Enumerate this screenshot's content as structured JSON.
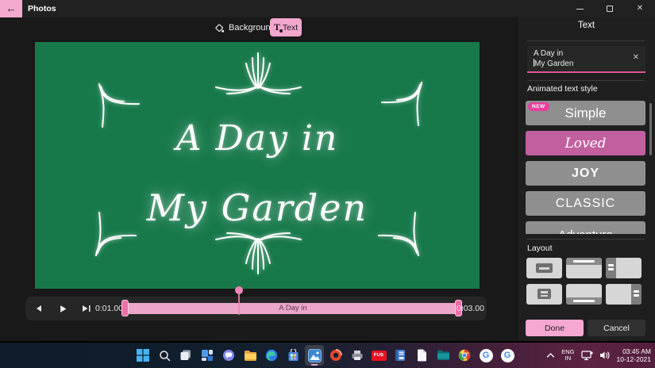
{
  "titlebar": {
    "app_title": "Photos",
    "back_glyph": "←",
    "close_glyph": "✕"
  },
  "toolbar": {
    "background_label": "Background",
    "text_icon_letter": "T",
    "text_label": "Text"
  },
  "canvas": {
    "line1": "A Day in",
    "line2": "My Garden",
    "background_color": "#17794a"
  },
  "playback": {
    "current_time": "0:01.00",
    "end_time": "0:03.00",
    "clip_label": "A Day in"
  },
  "panel": {
    "title": "Text",
    "input": {
      "line1": "A Day in",
      "line2": "My Garden",
      "clear_glyph": "✕"
    },
    "styles_heading": "Animated text style",
    "styles": [
      {
        "label": "Simple",
        "badge": "NEW",
        "selected": false
      },
      {
        "label": "Loved",
        "selected": true
      },
      {
        "label": "JOY",
        "selected": false
      },
      {
        "label": "CLASSIC",
        "selected": false
      },
      {
        "label": "Adventure",
        "selected": false,
        "partially_visible": true
      }
    ],
    "layout_heading": "Layout",
    "layout_options": [
      "center-box",
      "top-bar",
      "left-bar",
      "center-lines",
      "bottom-bar",
      "right-bar"
    ],
    "done_label": "Done",
    "cancel_label": "Cancel"
  },
  "taskbar": {
    "pub_label": "PUB",
    "google_letter": "G",
    "tray": {
      "lang_line1": "ENG",
      "lang_line2": "IN",
      "time": "03:45 AM",
      "date": "10-12-2021"
    }
  },
  "colors": {
    "accent_pink": "#f3a6ce",
    "selected_style_pink": "#c2609f",
    "input_underline": "#e0539b",
    "canvas_green": "#17794a",
    "timeline_pink": "#eba6c9"
  }
}
